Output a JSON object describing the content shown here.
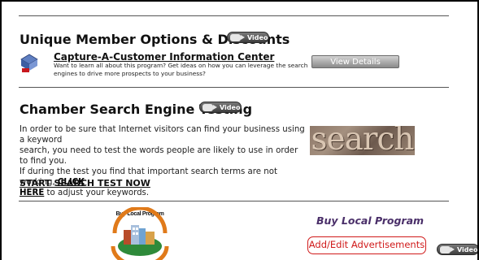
{
  "member_section": {
    "title": "Unique Member Options & Discounts",
    "video_label": "Video",
    "capture": {
      "title": "Capture-A-Customer Information Center",
      "description_line1": "Want to learn all about this program? Get ideas on how you can leverage the search",
      "description_line2": "engines to drive more prospects to your business?",
      "button_label": "View Details"
    }
  },
  "search_section": {
    "title": "Chamber Search Engine Testing",
    "video_label": "Video",
    "line1": "In order to be sure that Internet visitors can find your business using a keyword",
    "line2": "search, you need to test the words people are likely to use in order to find you.",
    "line3_prefix": "If during the test you find that important search terms are not working, ",
    "click": "CLICK",
    "here": "HERE",
    "line4_suffix": " to adjust your keywords.",
    "start_link": "START SEARCH TEST NOW",
    "image_word": "search"
  },
  "buy_local": {
    "logo_text": "Buy Local Program",
    "title": "Buy Local Program",
    "add_edit_label": "Add/Edit Advertisements",
    "video_label": "Video"
  }
}
